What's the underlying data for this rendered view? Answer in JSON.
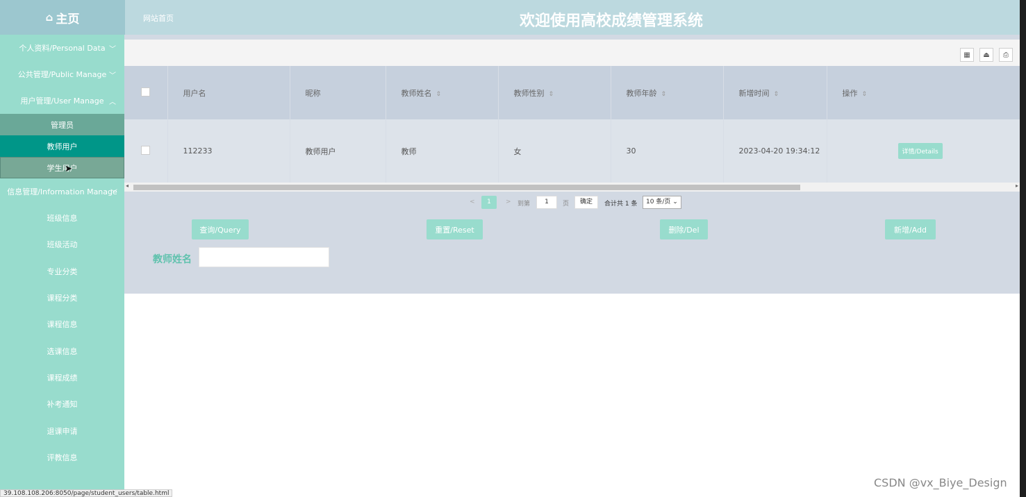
{
  "header": {
    "logo": "主页",
    "breadcrumb": "网站首页",
    "system_title": "欢迎使用高校成绩管理系统"
  },
  "sidebar": {
    "groups": [
      {
        "label": "个人资料/Personal Data",
        "chevron": "chevron-down"
      },
      {
        "label": "公共管理/Public Manage",
        "chevron": "chevron-down"
      },
      {
        "label": "用户管理/User Manage",
        "chevron": "chevron-up"
      }
    ],
    "user_sub_items": [
      "管理员",
      "教师用户",
      "学生用户"
    ],
    "active_sub_item": "教师用户",
    "info_group": {
      "label": "信息管理/Information Manage",
      "chevron": "chevron-down"
    },
    "info_items": [
      "班级信息",
      "班级活动",
      "专业分类",
      "课程分类",
      "课程信息",
      "选课信息",
      "课程成绩",
      "补考通知",
      "退课申请",
      "评教信息"
    ]
  },
  "toolbar": {
    "icons": [
      "columns-icon",
      "export-icon",
      "print-icon"
    ]
  },
  "table": {
    "columns": [
      "用户名",
      "昵称",
      "教师姓名",
      "教师性别",
      "教师年龄",
      "新增时间",
      "操作"
    ],
    "sortable": [
      false,
      false,
      true,
      true,
      true,
      true,
      true
    ],
    "rows": [
      {
        "username": "112233",
        "nickname": "教师用户",
        "teacher_name": "教师",
        "gender": "女",
        "age": "30",
        "created": "2023-04-20 19:34:12",
        "action": "详情/Details"
      }
    ]
  },
  "pager": {
    "prev": "<",
    "current_page": "1",
    "next": ">",
    "goto_label": "到第",
    "goto_value": "1",
    "page_unit": "页",
    "confirm": "确定",
    "total": "合计共 1 条",
    "page_size": "10 条/页"
  },
  "actions": {
    "query": "查询/Query",
    "reset": "重置/Reset",
    "delete": "删除/Del",
    "add": "新增/Add"
  },
  "search": {
    "teacher_name_label": "教师姓名",
    "teacher_name_value": ""
  },
  "status_bar_url": "39.108.108.206:8050/page/student_users/table.html",
  "watermark": "CSDN @vx_Biye_Design",
  "colors": {
    "accent": "#98dccd",
    "active": "#009688",
    "header": "#bcd9df",
    "label": "#5fc2ad"
  }
}
